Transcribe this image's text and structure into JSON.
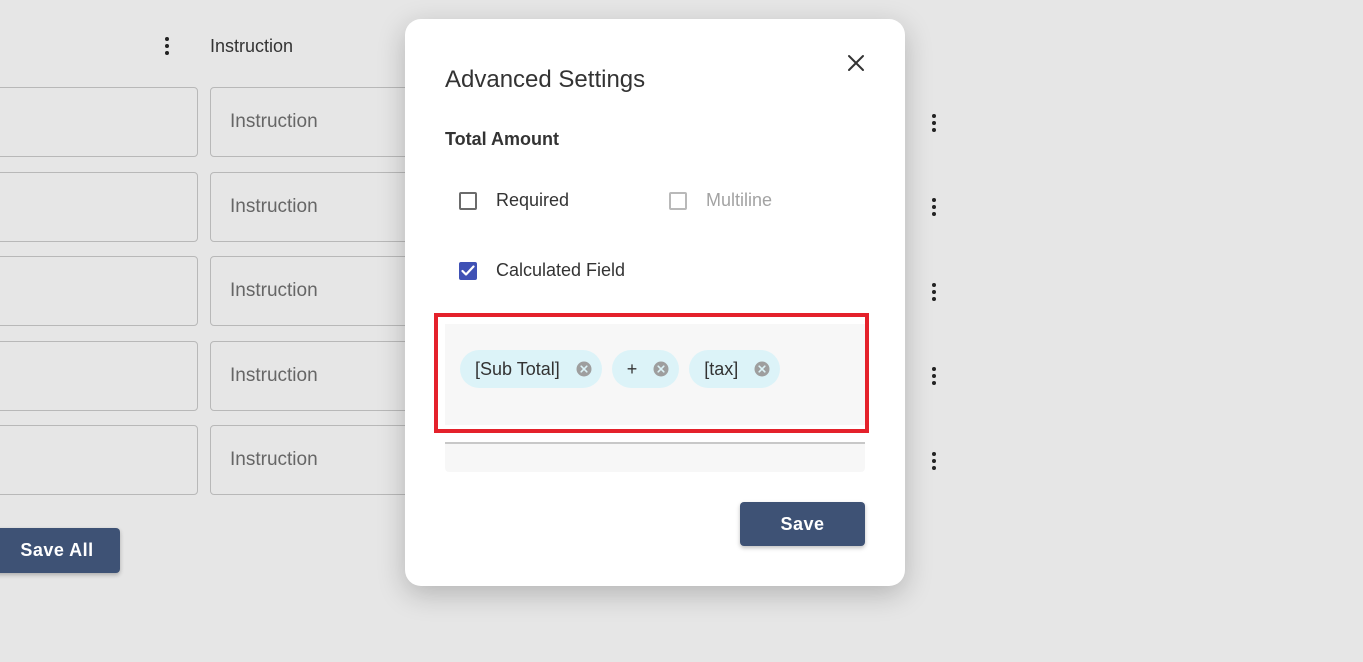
{
  "background": {
    "column_header": "Instruction",
    "rows": [
      {
        "instruction_placeholder": "Instruction"
      },
      {
        "instruction_placeholder": "Instruction"
      },
      {
        "instruction_placeholder": "Instruction"
      },
      {
        "instruction_placeholder": "Instruction"
      },
      {
        "instruction_placeholder": "Instruction"
      }
    ],
    "save_all_label": "Save All"
  },
  "modal": {
    "title": "Advanced Settings",
    "field_name": "Total Amount",
    "options": {
      "required": {
        "label": "Required",
        "checked": false,
        "disabled": false
      },
      "multiline": {
        "label": "Multiline",
        "checked": false,
        "disabled": true
      },
      "calculated": {
        "label": "Calculated Field",
        "checked": true,
        "disabled": false
      }
    },
    "formula_chips": [
      {
        "label": "[Sub Total]"
      },
      {
        "label": "+"
      },
      {
        "label": "[tax]"
      }
    ],
    "save_label": "Save",
    "close_icon": "close-icon",
    "colors": {
      "primary_button": "#3e5275",
      "checkbox_checked": "#3f51b5",
      "chip_background": "#dcf3f8",
      "highlight_border": "#e4212b"
    }
  }
}
